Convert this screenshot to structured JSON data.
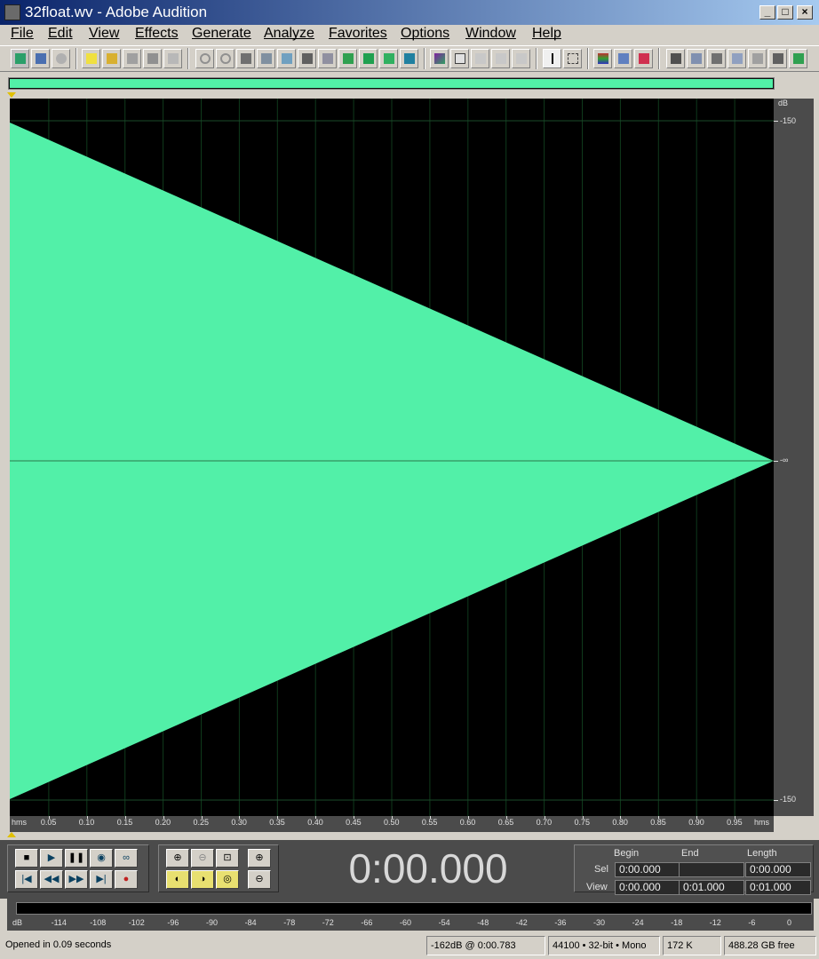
{
  "window": {
    "title": "32float.wv - Adobe Audition"
  },
  "menu": [
    "File",
    "Edit",
    "View",
    "Effects",
    "Generate",
    "Analyze",
    "Favorites",
    "Options",
    "Window",
    "Help"
  ],
  "colors": {
    "waveform": "#52f0a8",
    "background": "#000000",
    "panel": "#4b4b4b"
  },
  "db_scale": {
    "unit": "dB",
    "top": "-150",
    "center": "-∞",
    "bottom": "-150"
  },
  "time_ruler": {
    "unit_left": "hms",
    "unit_right": "hms",
    "ticks": [
      "0.05",
      "0.10",
      "0.15",
      "0.20",
      "0.25",
      "0.30",
      "0.35",
      "0.40",
      "0.45",
      "0.50",
      "0.55",
      "0.60",
      "0.65",
      "0.70",
      "0.75",
      "0.80",
      "0.85",
      "0.90",
      "0.95"
    ]
  },
  "transport": {
    "time": "0:00.000"
  },
  "selection": {
    "headers": {
      "begin": "Begin",
      "end": "End",
      "length": "Length"
    },
    "sel": {
      "label": "Sel",
      "begin": "0:00.000",
      "end": "",
      "length": "0:00.000"
    },
    "view": {
      "label": "View",
      "begin": "0:00.000",
      "end": "0:01.000",
      "length": "0:01.000"
    }
  },
  "meter": {
    "labels": [
      "dB",
      "-114",
      "-108",
      "-102",
      "-96",
      "-90",
      "-84",
      "-78",
      "-72",
      "-66",
      "-60",
      "-54",
      "-48",
      "-42",
      "-36",
      "-30",
      "-24",
      "-18",
      "-12",
      "-6",
      "0"
    ]
  },
  "status": {
    "message": "Opened in 0.09 seconds",
    "cursor": "-162dB @  0:00.783",
    "format": "44100 • 32-bit • Mono",
    "size": "172 K",
    "free": "488.28 GB free"
  }
}
